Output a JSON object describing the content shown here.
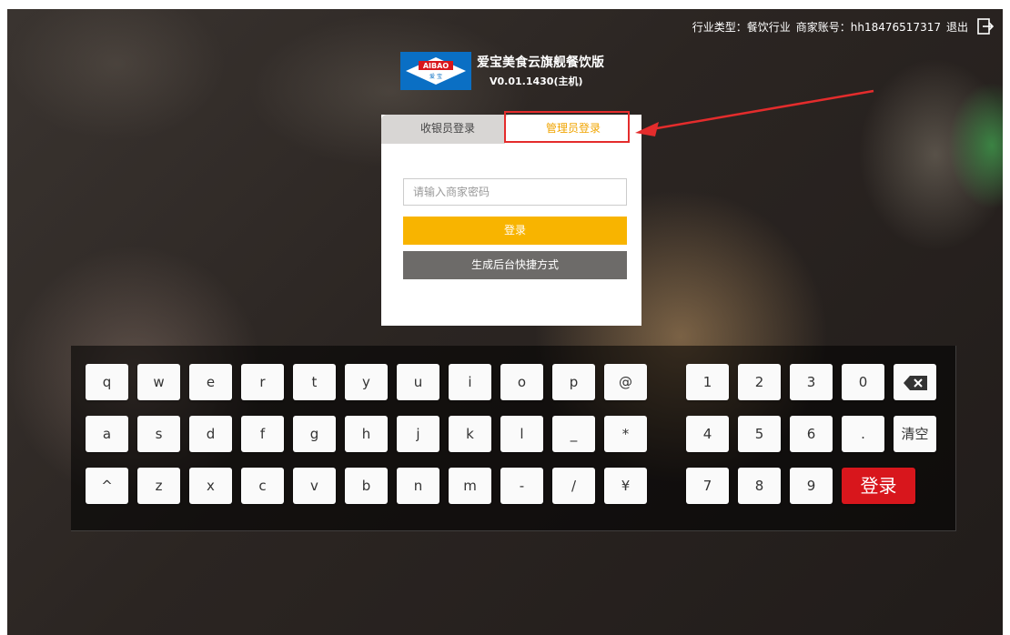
{
  "topbar": {
    "industry": "行业类型：餐饮行业",
    "account": "商家账号：hh18476517317",
    "logout": "退出",
    "logout_icon": "logout-icon"
  },
  "brand": {
    "logo_text": "AIBAO",
    "logo_sub": "爱 宝",
    "title": "爱宝美食云旗舰餐饮版",
    "version": "V0.01.1430(主机)"
  },
  "login_panel": {
    "tabs": [
      {
        "label": "收银员登录",
        "active": false
      },
      {
        "label": "管理员登录",
        "active": true
      }
    ],
    "password_placeholder": "请输入商家密码",
    "password_value": "",
    "login_button": "登录",
    "shortcut_button": "生成后台快捷方式"
  },
  "keyboard": {
    "letters": [
      [
        "q",
        "w",
        "e",
        "r",
        "t",
        "y",
        "u",
        "i",
        "o",
        "p",
        "@"
      ],
      [
        "a",
        "s",
        "d",
        "f",
        "g",
        "h",
        "j",
        "k",
        "l",
        "_",
        "*"
      ],
      [
        "^",
        "z",
        "x",
        "c",
        "v",
        "b",
        "n",
        "m",
        "-",
        "/",
        "¥"
      ]
    ],
    "numpad": [
      [
        "1",
        "2",
        "3",
        "0"
      ],
      [
        "4",
        "5",
        "6",
        "."
      ],
      [
        "7",
        "8",
        "9"
      ]
    ],
    "backspace_icon": "backspace-icon",
    "clear_label": "清空",
    "login_label": "登录"
  },
  "colors": {
    "accent_orange": "#f8b400",
    "annotation_red": "#e42c2c",
    "login_red": "#d8161c",
    "logo_blue": "#0a6fc4"
  }
}
